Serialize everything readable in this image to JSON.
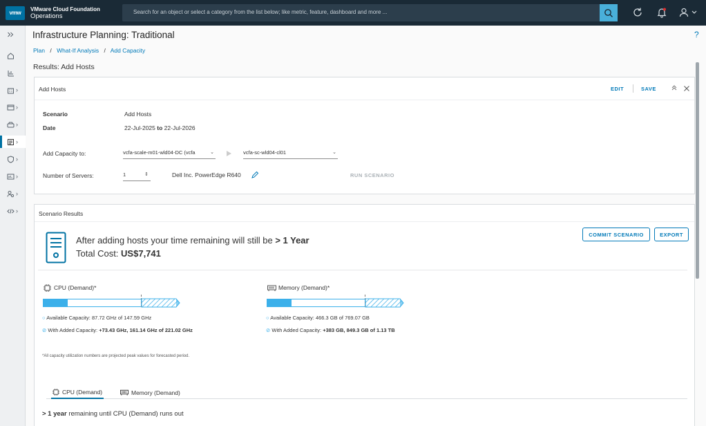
{
  "header": {
    "logo_text": "vmw",
    "product_line1": "VMware Cloud Foundation",
    "product_line2": "Operations",
    "search_placeholder": "Search for an object or select a category from the list below; like metric, feature, dashboard and more ..."
  },
  "page": {
    "title": "Infrastructure Planning: Traditional",
    "help": "?",
    "breadcrumbs": [
      "Plan",
      "What-If Analysis",
      "Add Capacity"
    ],
    "results_title": "Results: Add Hosts"
  },
  "add_hosts_panel": {
    "title": "Add Hosts",
    "edit_label": "EDIT",
    "save_label": "SAVE",
    "scenario_label": "Scenario",
    "scenario_value": "Add Hosts",
    "date_label": "Date",
    "date_from": "22-Jul-2025",
    "date_to_word": "to",
    "date_to": "22-Jul-2026",
    "add_capacity_label": "Add Capacity to:",
    "datacenter_value": "vcfa-scale-m01-wld04-DC (vcfa",
    "cluster_value": "vcfa-sc-wld04-cl01",
    "servers_label": "Number of Servers:",
    "servers_value": "1",
    "server_model": "Dell Inc. PowerEdge R640",
    "run_label": "RUN SCENARIO"
  },
  "results_panel": {
    "title": "Scenario Results",
    "headline_prefix": "After adding hosts your time remaining will still be",
    "headline_value": "> 1 Year",
    "cost_label": "Total Cost:",
    "cost_value": "US$7,741",
    "commit_label": "COMMIT SCENARIO",
    "export_label": "EXPORT",
    "cpu": {
      "title": "CPU (Demand)*",
      "fill_percent": 25,
      "available_label": "Available Capacity:",
      "available_value": "87.72 GHz of 147.59 GHz",
      "added_label": "With Added Capacity:",
      "added_value": "+73.43 GHz, 161.14 GHz of 221.02 GHz"
    },
    "memory": {
      "title": "Memory (Demand)*",
      "fill_percent": 25,
      "available_label": "Available Capacity:",
      "available_value": "466.3 GB of 769.07 GB",
      "added_label": "With Added Capacity:",
      "added_value": "+383 GB, 849.3 GB of 1.13 TB"
    },
    "footnote": "*All capacity utilization numbers are projected peak values for forecasted period.",
    "tabs": [
      "CPU (Demand)",
      "Memory (Demand)"
    ],
    "remaining_value": "> 1 year",
    "remaining_text": "remaining until CPU (Demand) runs out"
  },
  "colors": {
    "header_bg": "#1a2a36",
    "accent": "#0079b8",
    "bar_fill": "#3cb0ea"
  }
}
